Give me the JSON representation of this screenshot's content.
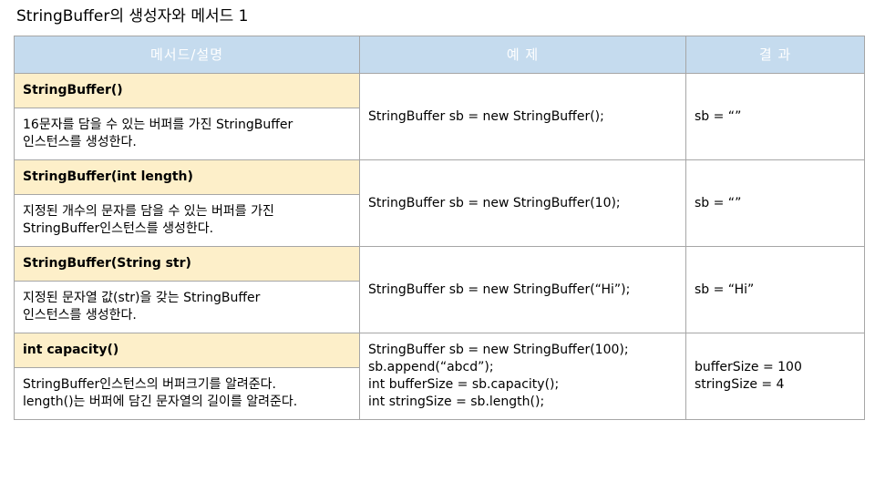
{
  "slide": {
    "title": "StringBuffer의 생성자와 메서드 1"
  },
  "table": {
    "headers": [
      "메서드/설명",
      "예 제",
      "결 과"
    ],
    "rows": [
      {
        "signature": "StringBuffer()",
        "description": " 16문자를 담을 수 있는 버퍼를 가진 StringBuffer\n인스턴스를 생성한다.",
        "example": "StringBuffer sb = new StringBuffer();",
        "result": "sb = “”"
      },
      {
        "signature": "StringBuffer(int length)",
        "description": " 지정된 개수의 문자를 담을 수 있는 버퍼를 가진\nStringBuffer인스턴스를 생성한다.",
        "example": "StringBuffer sb = new StringBuffer(10);",
        "result": "sb = “”"
      },
      {
        "signature": "StringBuffer(String str)",
        "description": " 지정된 문자열 값(str)을 갖는 StringBuffer\n인스턴스를 생성한다.",
        "example": "StringBuffer sb = new StringBuffer(“Hi”);",
        "result": "sb = “Hi”"
      },
      {
        "signature": "int capacity()",
        "description": " StringBuffer인스턴스의 버퍼크기를 알려준다.\nlength()는 버퍼에 담긴 문자열의 길이를 알려준다.",
        "example": "StringBuffer sb = new StringBuffer(100);\nsb.append(“abcd”);\nint bufferSize = sb.capacity();\nint stringSize = sb.length();",
        "result": "bufferSize = 100\nstringSize = 4"
      }
    ]
  }
}
